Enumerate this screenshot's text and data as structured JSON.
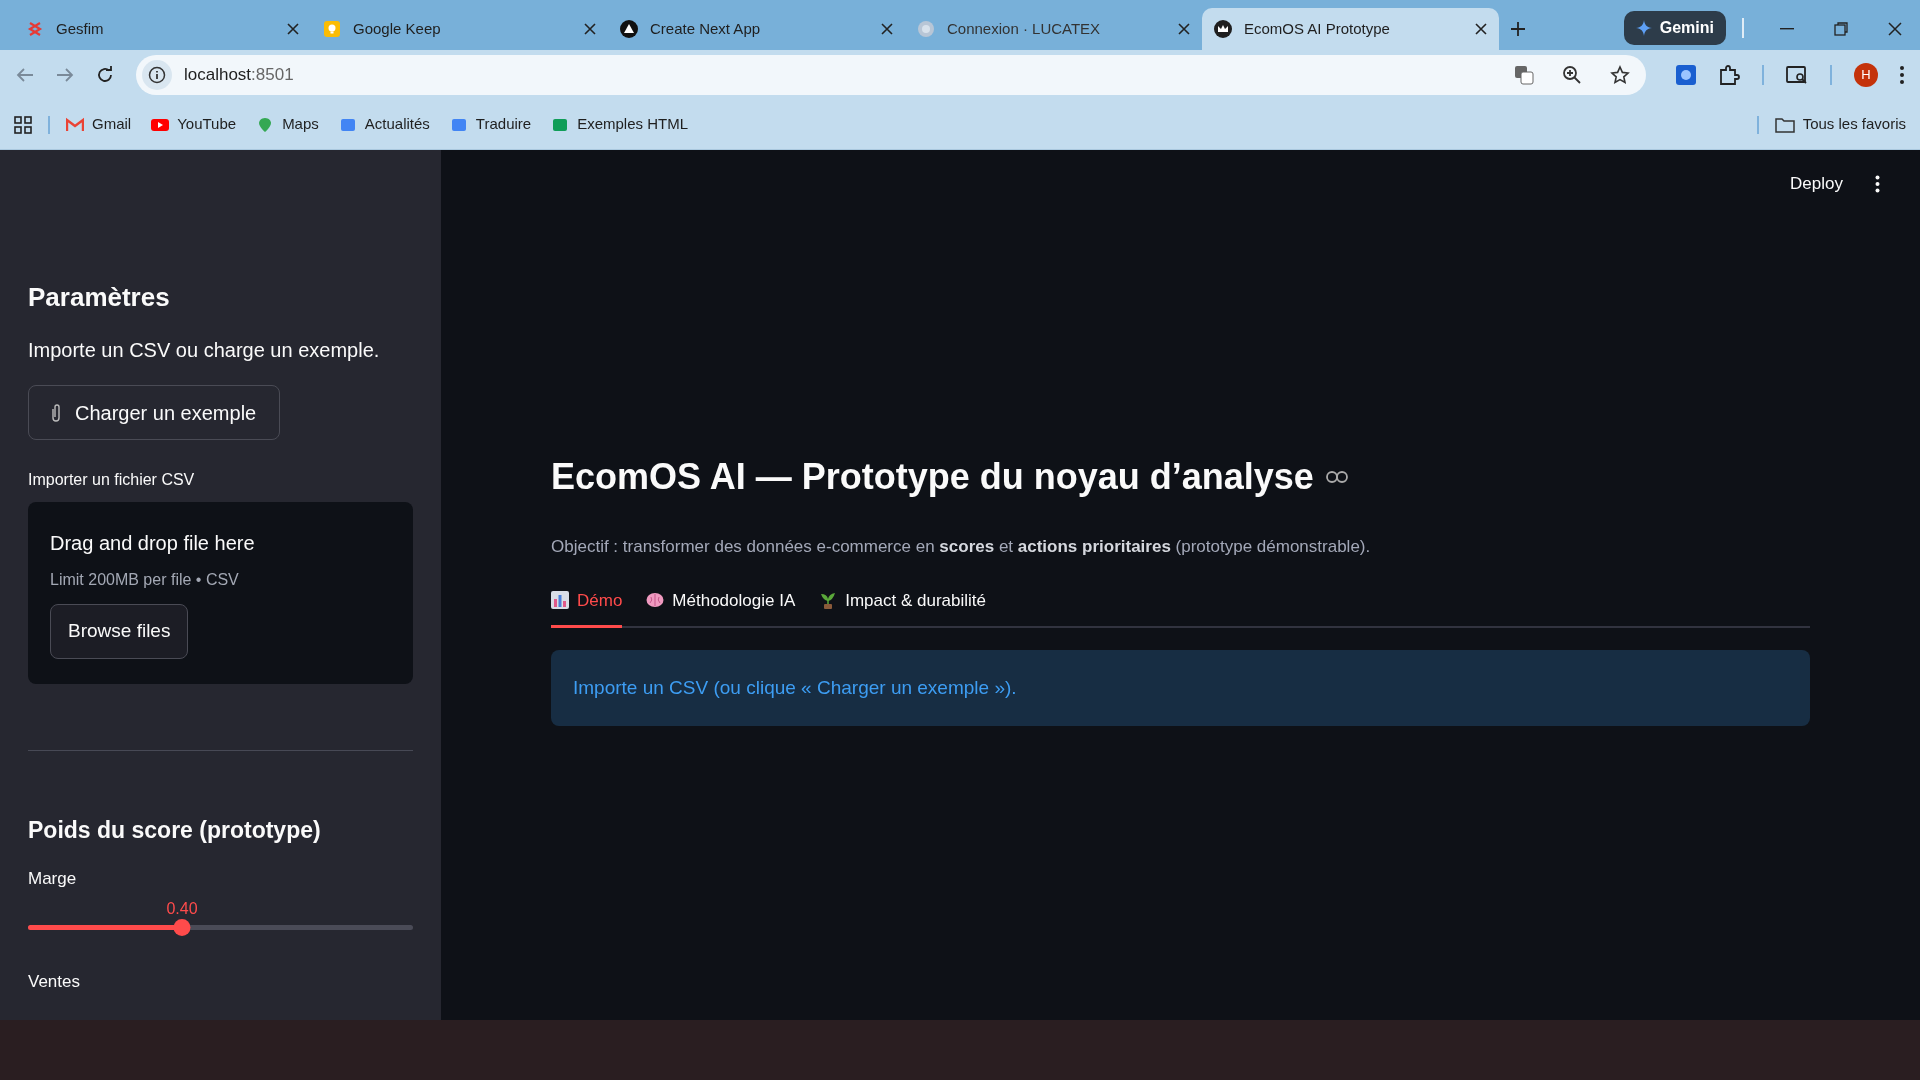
{
  "browser": {
    "tabs": [
      {
        "title": "Gesfim",
        "selected": false
      },
      {
        "title": "Google Keep",
        "selected": false
      },
      {
        "title": "Create Next App",
        "selected": false
      },
      {
        "title": "Connexion · LUCATEX",
        "selected": false
      },
      {
        "title": "EcomOS AI Prototype",
        "selected": true
      }
    ],
    "gemini": "Gemini",
    "address": {
      "host": "localhost",
      "port": ":8501"
    },
    "avatar": "H",
    "bookmarks": [
      "Gmail",
      "YouTube",
      "Maps",
      "Actualités",
      "Traduire",
      "Exemples HTML"
    ],
    "all_bookmarks": "Tous les favoris"
  },
  "app": {
    "deploy": "Deploy",
    "sidebar": {
      "heading": "Paramètres",
      "caption": "Importe un CSV ou charge un exemple.",
      "example_button": "Charger un exemple",
      "uploader_label": "Importer un fichier CSV",
      "dropzone_title": "Drag and drop file here",
      "dropzone_hint": "Limit 200MB per file • CSV",
      "browse_button": "Browse files",
      "weights_heading": "Poids du score (prototype)",
      "sliders": [
        {
          "label": "Marge",
          "reading": "0.40",
          "level": 0.4
        },
        {
          "label": "Ventes"
        }
      ]
    },
    "title": "EcomOS AI — Prototype du noyau d’analyse",
    "subtitle": "Objectif : transformer des données e-commerce en **scores** et **actions prioritaires** (prototype démonstrable).",
    "tabs": [
      {
        "label": "Démo",
        "selected": true
      },
      {
        "label": "Méthodologie IA",
        "selected": false
      },
      {
        "label": "Impact & durabilité",
        "selected": false
      }
    ],
    "info": "Importe un CSV (ou clique « Charger un exemple »)."
  }
}
